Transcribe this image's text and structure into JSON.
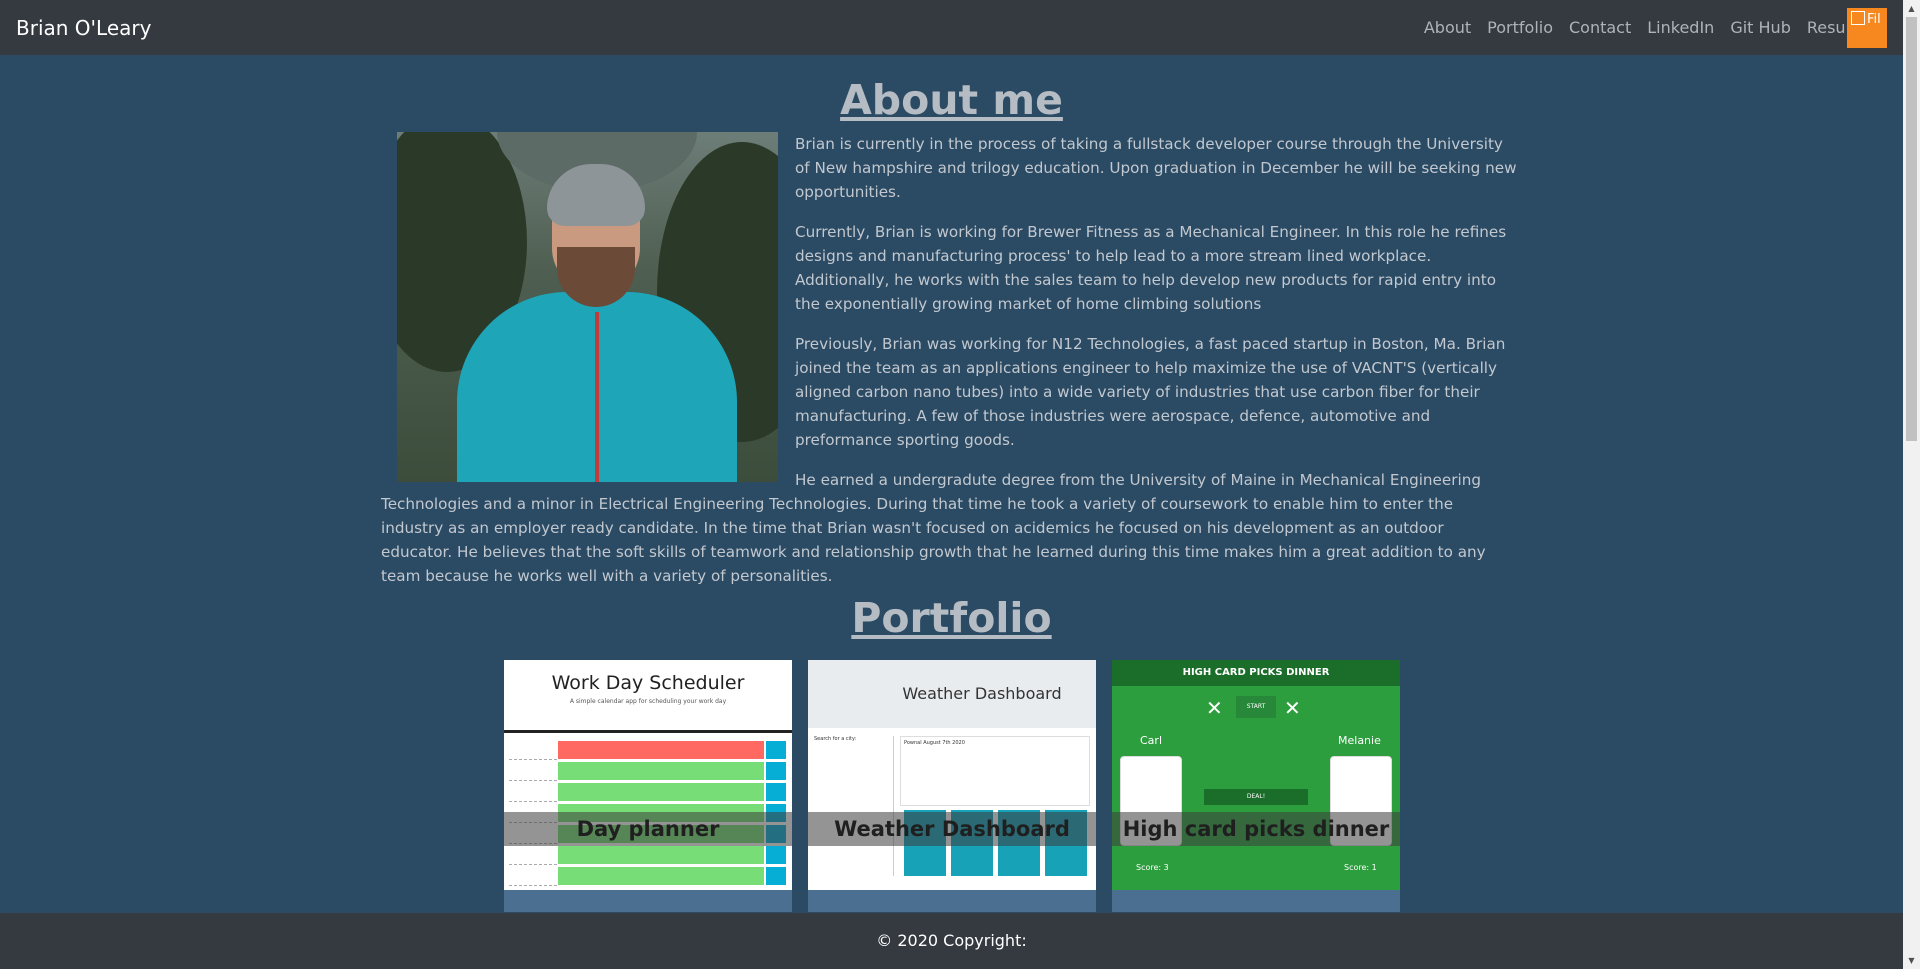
{
  "navbar": {
    "brand": "Brian O'Leary",
    "links": [
      "About",
      "Portfolio",
      "Contact",
      "LinkedIn",
      "Git Hub",
      "Resume"
    ],
    "widget_label": "Fil"
  },
  "about": {
    "title": "About me",
    "paragraphs": [
      "Brian is currently in the process of taking a fullstack developer course through the University of New hampshire and trilogy education. Upon graduation in December he will be seeking new opportunities.",
      "Currently, Brian is working for Brewer Fitness as a Mechanical Engineer. In this role he refines designs and manufacturing process' to help lead to a more stream lined workplace. Additionally, he works with the sales team to help develop new products for rapid entry into the exponentially growing market of home climbing solutions",
      "Previously, Brian was working for N12 Technologies, a fast paced startup in Boston, Ma. Brian joined the team as an applications engineer to help maximize the use of VACNT'S (vertically aligned carbon nano tubes) into a wide variety of industries that use carbon fiber for their manufacturing. A few of those industries were aerospace, defence, automotive and preformance sporting goods.",
      "He earned a undergradute degree from the University of Maine in Mechanical Engineering Technologies and a minor in Electrical Engineering Technologies. During that time he took a variety of coursework to enable him to enter the industry as an employer ready candidate. In the time that Brian wasn't focused on acidemics he focused on his development as an outdoor educator. He believes that the soft skills of teamwork and relationship growth that he learned during this time makes him a great addition to any team because he works well with a variety of personalities."
    ]
  },
  "portfolio": {
    "title": "Portfolio",
    "cards": [
      {
        "caption": "Day planner",
        "thumb_title": "Work Day Scheduler",
        "thumb_subtitle": "A simple calendar app for scheduling your work day"
      },
      {
        "caption": "Weather Dashboard",
        "thumb_title": "Weather Dashboard",
        "thumb_search_label": "Search for a city:",
        "thumb_city_header": "Pownal August 7th 2020"
      },
      {
        "caption": "High card picks dinner",
        "thumb_title": "HIGH CARD PICKS DINNER",
        "thumb_start": "START",
        "thumb_deal": "DEAL!",
        "player1": "Carl",
        "player2": "Melanie",
        "score1": "Score: 3",
        "score2": "Score: 1"
      }
    ]
  },
  "footer": {
    "text": "© 2020 Copyright:"
  },
  "colors": {
    "page_bg": "#2b4a63",
    "navbar_bg": "#343a40",
    "widget": "#f7871f",
    "card_bg": "#4a6f90"
  }
}
